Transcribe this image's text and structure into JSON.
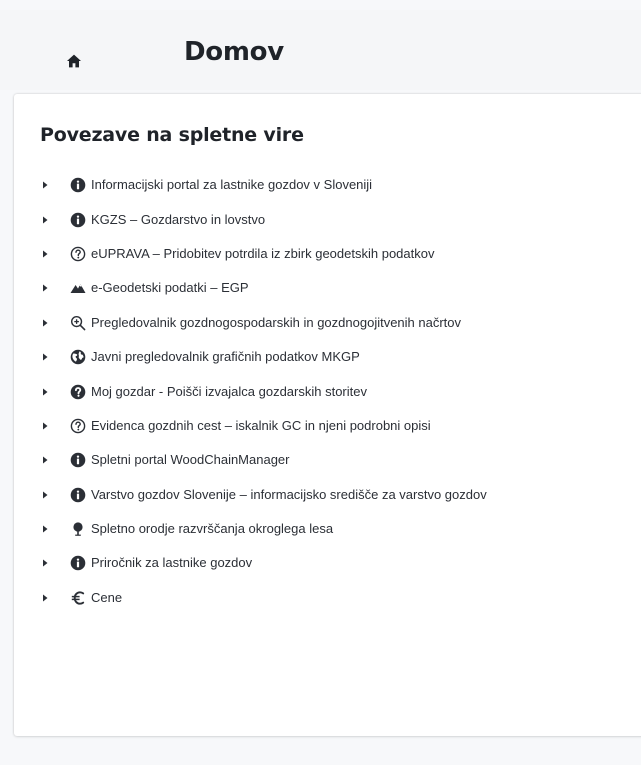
{
  "header": {
    "title": "Domov",
    "home_icon": "home-icon"
  },
  "section": {
    "title": "Povezave na spletne vire"
  },
  "links": [
    {
      "icon": "info-circle-icon",
      "label": "Informacijski portal za lastnike gozdov v Sloveniji"
    },
    {
      "icon": "info-circle-icon",
      "label": "KGZS – Gozdarstvo in lovstvo"
    },
    {
      "icon": "question-circle-outline-icon",
      "label": "eUPRAVA – Pridobitev potrdila iz zbirk geodetskih podatkov"
    },
    {
      "icon": "mountains-icon",
      "label": "e-Geodetski podatki – EGP"
    },
    {
      "icon": "zoom-in-icon",
      "label": "Pregledovalnik gozdnogospodarskih in gozdnogojitvenih načrtov"
    },
    {
      "icon": "globe-icon",
      "label": "Javni pregledovalnik grafičnih podatkov MKGP"
    },
    {
      "icon": "question-circle-filled-icon",
      "label": "Moj gozdar - Poišči izvajalca gozdarskih storitev"
    },
    {
      "icon": "question-circle-outline-icon",
      "label": "Evidenca gozdnih cest – iskalnik GC in njeni podrobni opisi"
    },
    {
      "icon": "info-circle-icon",
      "label": "Spletni portal WoodChainManager"
    },
    {
      "icon": "info-circle-icon",
      "label": "Varstvo gozdov Slovenije – informacijsko središče za varstvo gozdov"
    },
    {
      "icon": "tree-icon",
      "label": "Spletno orodje razvrščanja okroglega lesa"
    },
    {
      "icon": "info-circle-icon",
      "label": "Priročnik za lastnike gozdov"
    },
    {
      "icon": "euro-icon",
      "label": "Cene"
    }
  ]
}
